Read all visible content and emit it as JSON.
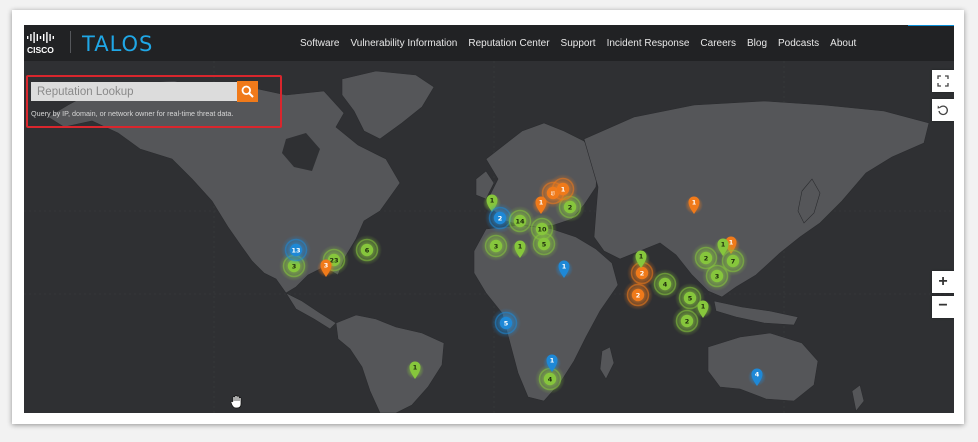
{
  "brand": {
    "cisco_text": "CISCO",
    "talos_text": "TALOS"
  },
  "nav": {
    "items": [
      "Software",
      "Vulnerability Information",
      "Reputation Center",
      "Support",
      "Incident Response",
      "Careers",
      "Blog",
      "Podcasts",
      "About"
    ]
  },
  "lookup": {
    "placeholder": "Reputation Lookup",
    "hint": "Query by IP, domain, or network owner for real-time threat data.",
    "search_icon": "search-icon"
  },
  "map_controls": {
    "fullscreen_icon": "fullscreen-icon",
    "reset_icon": "reset-view-icon",
    "zoom_in": "+",
    "zoom_out": "−"
  },
  "colors": {
    "green": "#86c63c",
    "orange": "#f07a1a",
    "blue": "#1e88d6",
    "accent_bar": "#0a8fd8",
    "highlight_border": "#d9262d"
  },
  "markers": {
    "badges": [
      "3",
      "13",
      "23",
      "6",
      "1",
      "2",
      "14",
      "1",
      "10",
      "5",
      "3",
      "1",
      "2",
      "8",
      "1",
      "2",
      "1",
      "1",
      "2",
      "4",
      "5",
      "2",
      "1",
      "1",
      "7",
      "3",
      "2",
      "4",
      "1",
      "5",
      "1",
      "3",
      "4",
      "1",
      "1"
    ]
  }
}
